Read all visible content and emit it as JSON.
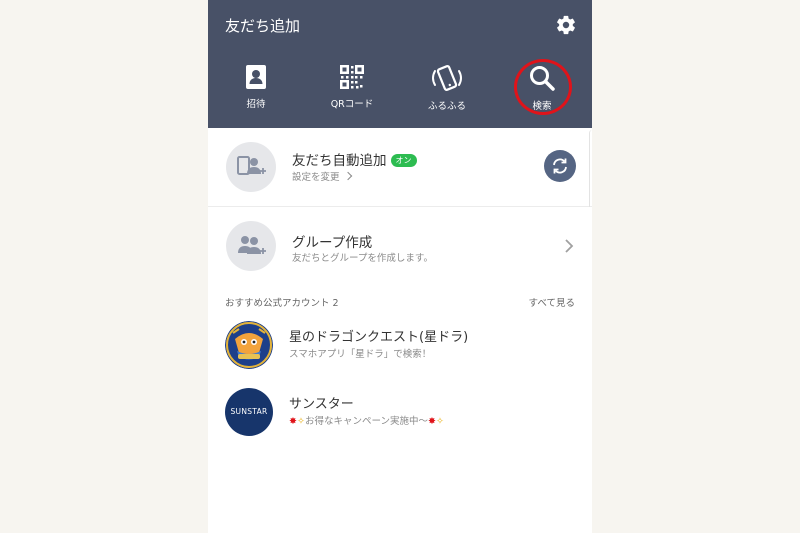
{
  "header": {
    "title": "友だち追加",
    "settings_icon": "gear-icon",
    "background": "#485167"
  },
  "tabs": [
    {
      "label": "招待",
      "icon": "contact-book-icon"
    },
    {
      "label": "QRコード",
      "icon": "qr-code-icon"
    },
    {
      "label": "ふるふる",
      "icon": "shake-phone-icon"
    },
    {
      "label": "検索",
      "icon": "search-icon"
    }
  ],
  "highlight_color": "#e0131a",
  "auto_add": {
    "title": "友だち自動追加",
    "badge": "オン",
    "subtitle": "設定を変更",
    "badge_color": "#2dbc51",
    "sync_icon": "sync-icon"
  },
  "group_create": {
    "title": "グループ作成",
    "subtitle": "友だちとグループを作成します。"
  },
  "recommend": {
    "label": "おすすめ公式アカウント 2",
    "see_all": "すべて見る",
    "accounts": [
      {
        "name": "星のドラゴンクエスト(星ドラ)",
        "subtitle": "スマホアプリ「星ドラ」で検索！",
        "avatar": "dragon-quest-avatar"
      },
      {
        "name": "サンスター",
        "subtitle_text": "お得なキャンペーン実施中〜",
        "avatar_text": "SUNSTAR",
        "avatar_color": "#17356b"
      }
    ]
  }
}
